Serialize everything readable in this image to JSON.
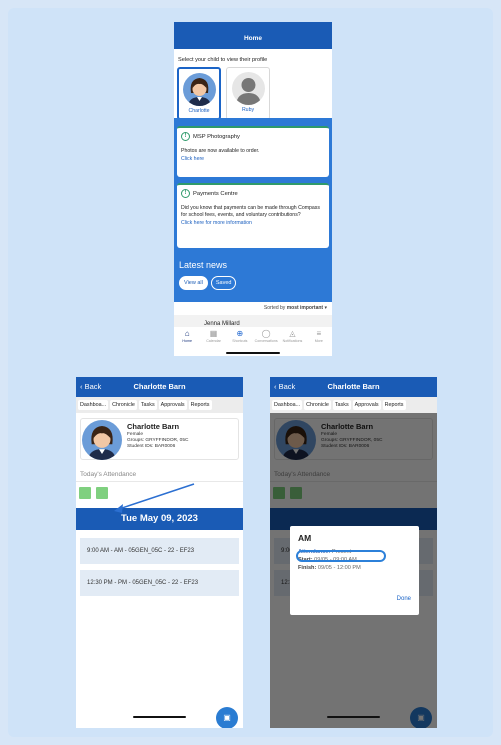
{
  "home": {
    "title": "Home",
    "select_prompt": "Select your child to view their profile",
    "children": [
      {
        "name": "Charlotte",
        "selected": true
      },
      {
        "name": "Ruby",
        "selected": false
      }
    ],
    "cards": [
      {
        "title": "MSP Photography",
        "body": "Photos are now available to order.",
        "link": "Click here"
      },
      {
        "title": "Payments Centre",
        "body": "Did you know that payments can be made through Compass for school fees, events, and voluntary contributions?",
        "link": "Click here for more information"
      }
    ],
    "latest_news": "Latest news",
    "view_all": "View all",
    "saved": "Saved",
    "sorted_prefix": "Sorted by",
    "sorted_value": "most important",
    "news_author": "Jenna Millard",
    "tabbar": [
      {
        "label": "Home",
        "icon": "home-icon"
      },
      {
        "label": "Calendar",
        "icon": "calendar-icon"
      },
      {
        "label": "Shortcuts",
        "icon": "plus-icon"
      },
      {
        "label": "Conversations",
        "icon": "chat-icon"
      },
      {
        "label": "Notifications",
        "icon": "bell-icon"
      },
      {
        "label": "More",
        "icon": "menu-icon"
      }
    ]
  },
  "profile": {
    "back": "Back",
    "title": "Charlotte Barn",
    "tabs": [
      "Dashboa...",
      "Chronicle",
      "Tasks",
      "Approvals",
      "Reports"
    ],
    "name": "Charlotte Barn",
    "gender": "Female",
    "groups": "Groups: GRYFFINDOR, 05C",
    "student_id": "Student IDs: BAR0006",
    "attendance_label": "Today's Attendance",
    "date": "Tue May 09, 2023",
    "slots": [
      "9:00 AM - AM - 05GEN_05C - 22 - EF23",
      "12:30 PM - PM - 05GEN_05C - 22 - EF23"
    ]
  },
  "modal": {
    "title": "AM",
    "attendance_key": "Attendance:",
    "attendance_val": "Present",
    "start_key": "Start:",
    "start_val": "09/05 - 09:00 AM",
    "finish_key": "Finish:",
    "finish_val": "09/05 - 12:00 PM",
    "done": "Done"
  },
  "colors": {
    "brand": "#1a5bb5",
    "present": "#7fd07f",
    "accent": "#2c80d9"
  }
}
